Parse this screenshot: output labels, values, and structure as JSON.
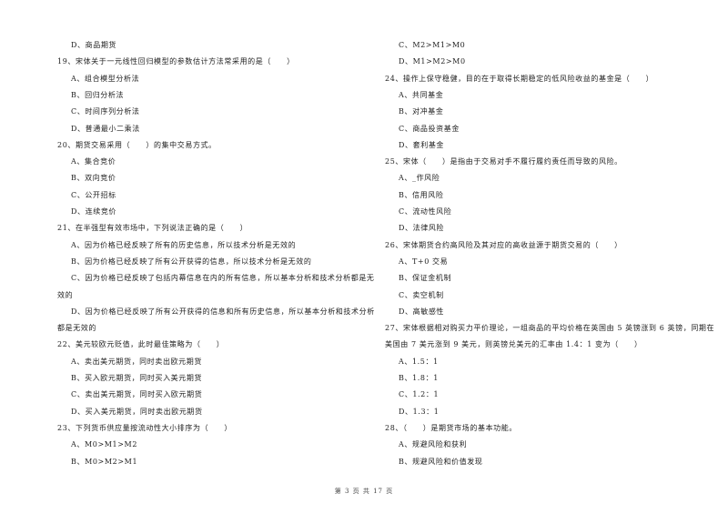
{
  "page": {
    "footer": "第 3 页 共 17 页"
  },
  "left_column": [
    {
      "type": "option",
      "text": "D、商品期货"
    },
    {
      "type": "question",
      "text": "19、宋体关于一元线性回归模型的参数估计方法常采用的是（　　）"
    },
    {
      "type": "option",
      "text": "A、组合模型分析法"
    },
    {
      "type": "option",
      "text": "B、回归分析法"
    },
    {
      "type": "option",
      "text": "C、时间序列分析法"
    },
    {
      "type": "option",
      "text": "D、普通最小二乘法"
    },
    {
      "type": "question",
      "text": "20、期货交易采用（　　）的集中交易方式。"
    },
    {
      "type": "option",
      "text": "A、集合竞价"
    },
    {
      "type": "option",
      "text": "B、双向竞价"
    },
    {
      "type": "option",
      "text": "C、公开招标"
    },
    {
      "type": "option",
      "text": "D、连续竞价"
    },
    {
      "type": "question",
      "text": "21、在半强型有效市场中，下列说法正确的是（　　）"
    },
    {
      "type": "option",
      "text": "A、因为价格已经反映了所有的历史信息，所以技术分析是无效的"
    },
    {
      "type": "option",
      "text": "B、因为价格已经反映了所有公开获得的信息，所以技术分析是无效的"
    },
    {
      "type": "option",
      "text": "C、因为价格已经反映了包括内幕信息在内的所有信息，所以基本分析和技术分析都是无"
    },
    {
      "type": "cont",
      "text": "效的"
    },
    {
      "type": "option",
      "text": "D、因为价格已经反映了所有公开获得的信息和所有历史信息，所以基本分析和技术分析"
    },
    {
      "type": "cont",
      "text": "都是无效的"
    },
    {
      "type": "question",
      "text": "22、美元较欧元贬值，此时最佳策略为（　　）"
    },
    {
      "type": "option",
      "text": "A、卖出美元期货，同时卖出欧元期货"
    },
    {
      "type": "option",
      "text": "B、买入欧元期货，同时买入美元期货"
    },
    {
      "type": "option",
      "text": "C、卖出美元期货，同时买入欧元期货"
    },
    {
      "type": "option",
      "text": "D、买入美元期货，同时卖出欧元期货"
    },
    {
      "type": "question",
      "text": "23、下列货币供应量按流动性大小排序为（　　）"
    },
    {
      "type": "option",
      "text": "A、M0>M1>M2"
    },
    {
      "type": "option",
      "text": "B、M0>M2>M1"
    }
  ],
  "right_column": [
    {
      "type": "option",
      "text": "C、M2>M1>M0"
    },
    {
      "type": "option",
      "text": "D、M1>M2>M0"
    },
    {
      "type": "question",
      "text": "24、操作上保守稳健，目的在于取得长期稳定的低风险收益的基金是（　　）"
    },
    {
      "type": "option",
      "text": "A、共同基金"
    },
    {
      "type": "option",
      "text": "B、对冲基金"
    },
    {
      "type": "option",
      "text": "C、商品投资基金"
    },
    {
      "type": "option",
      "text": "D、套利基金"
    },
    {
      "type": "question",
      "text": "25、宋体（　　）是指由于交易对手不履行履约责任而导致的风险。"
    },
    {
      "type": "option",
      "text": "A、_作风险"
    },
    {
      "type": "option",
      "text": "B、信用风险"
    },
    {
      "type": "option",
      "text": "C、流动性风险"
    },
    {
      "type": "option",
      "text": "D、法律风险"
    },
    {
      "type": "question",
      "text": "26、宋体期货合约高风险及其对应的高收益源于期货交易的（　　）"
    },
    {
      "type": "option",
      "text": "A、T+0 交易"
    },
    {
      "type": "option",
      "text": "B、保证金机制"
    },
    {
      "type": "option",
      "text": "C、卖空机制"
    },
    {
      "type": "option",
      "text": "D、高敏感性"
    },
    {
      "type": "question",
      "text": "27、宋体根据相对购买力平价理论，一组商品的平均价格在英国由 5 英镑涨到 6 英镑，同期在"
    },
    {
      "type": "cont",
      "text": "美国由 7 美元涨到 9 美元，则英镑兑美元的汇率由 1.4：1 变为（　　）"
    },
    {
      "type": "option",
      "text": "A、1.5：1"
    },
    {
      "type": "option",
      "text": "B、1.8：1"
    },
    {
      "type": "option",
      "text": "C、1.2：1"
    },
    {
      "type": "option",
      "text": "D、1.3：1"
    },
    {
      "type": "question",
      "text": "28、（　　）是期货市场的基本功能。"
    },
    {
      "type": "option",
      "text": "A、规避风险和获利"
    },
    {
      "type": "option",
      "text": "B、规避风险和价值发现"
    }
  ]
}
